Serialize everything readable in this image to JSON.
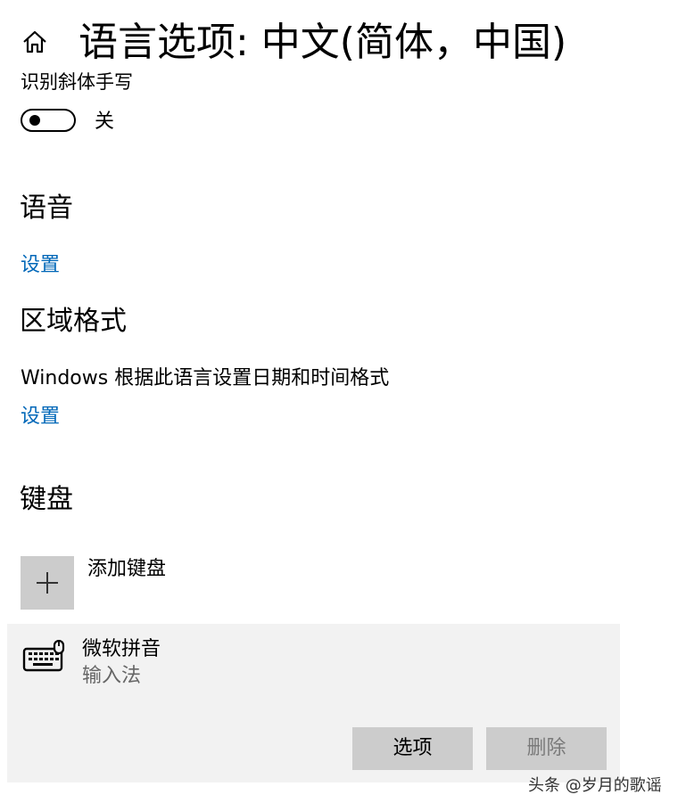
{
  "header": {
    "home_icon": "home-icon",
    "title": "语言选项: 中文(简体，中国)"
  },
  "handwriting": {
    "label": "识别斜体手写",
    "toggle_state": "关",
    "toggle_on": false
  },
  "speech": {
    "heading": "语音",
    "settings_link": "设置"
  },
  "regional_format": {
    "heading": "区域格式",
    "description": "Windows 根据此语言设置日期和时间格式",
    "settings_link": "设置"
  },
  "keyboards": {
    "heading": "键盘",
    "add_label": "添加键盘",
    "add_icon": "plus-icon",
    "items": [
      {
        "icon": "keyboard-icon",
        "name": "微软拼音",
        "type": "输入法",
        "options_label": "选项",
        "delete_label": "删除"
      }
    ]
  },
  "watermark": "头条 @岁月的歌谣",
  "colors": {
    "link": "#0067b8",
    "panel": "#f2f2f2",
    "button": "#cccccc",
    "disabled_text": "#7a7a7a"
  }
}
